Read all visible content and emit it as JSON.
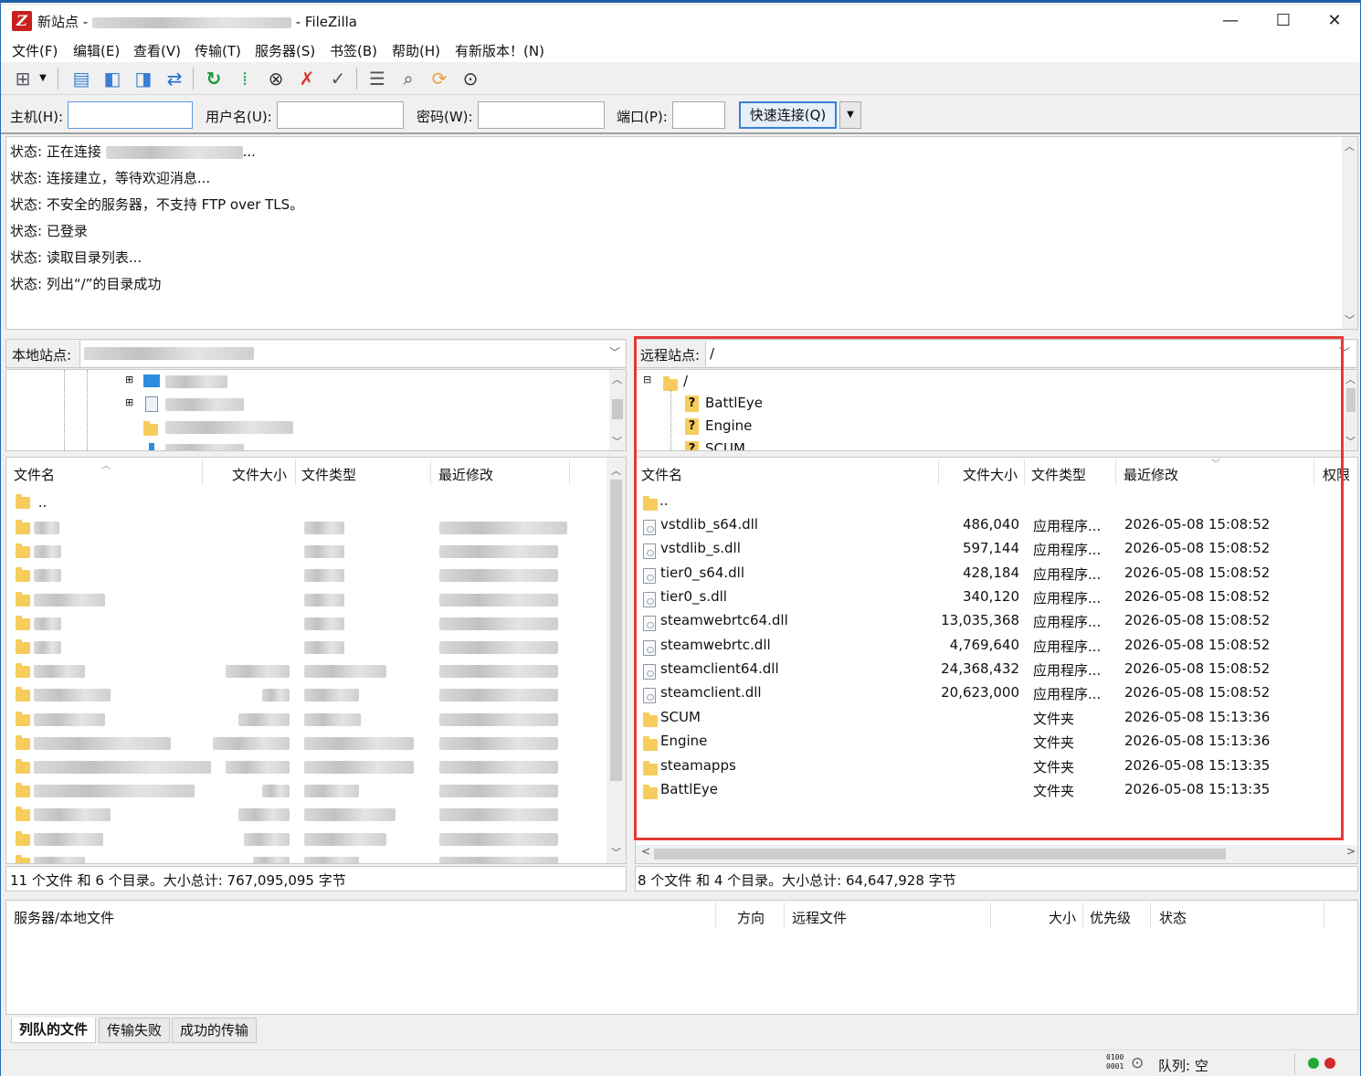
{
  "window": {
    "app_title": "新站点 - ",
    "app_name_suffix": "- FileZilla",
    "minimize": "—",
    "maximize": "☐",
    "close": "✕"
  },
  "menu": [
    "文件(F)",
    "编辑(E)",
    "查看(V)",
    "传输(T)",
    "服务器(S)",
    "书签(B)",
    "帮助(H)",
    "有新版本！(N)"
  ],
  "quickconnect": {
    "host_label": "主机(H):",
    "user_label": "用户名(U):",
    "pass_label": "密码(W):",
    "port_label": "端口(P):",
    "connect_label": "快速连接(Q)",
    "host_value": "",
    "user_value": "",
    "pass_value": "",
    "port_value": ""
  },
  "log": [
    {
      "text": "状态: 正在连接 ",
      "suffix": "..."
    },
    {
      "text": "状态: 连接建立，等待欢迎消息...",
      "suffix": ""
    },
    {
      "text": "状态: 不安全的服务器，不支持 FTP over TLS。",
      "suffix": ""
    },
    {
      "text": "状态: 已登录",
      "suffix": ""
    },
    {
      "text": "状态: 读取目录列表...",
      "suffix": ""
    },
    {
      "text": "状态: 列出“/”的目录成功",
      "suffix": ""
    }
  ],
  "local": {
    "site_label": "本地站点:",
    "columns": {
      "name": "文件名",
      "size": "文件大小",
      "type": "文件类型",
      "modified": "最近修改"
    },
    "parent": "..",
    "status": "11 个文件 和 6 个目录。大小总计: 767,095,095 字节"
  },
  "remote": {
    "site_label": "远程站点:",
    "path": "/",
    "tree": {
      "root": "/",
      "children": [
        "BattlEye",
        "Engine",
        "SCUM"
      ]
    },
    "columns": {
      "name": "文件名",
      "size": "文件大小",
      "type": "文件类型",
      "modified": "最近修改",
      "perm": "权限"
    },
    "parent": "..",
    "files": [
      {
        "name": "vstdlib_s64.dll",
        "size": "486,040",
        "type": "应用程序...",
        "modified": "2026-05-08 15:08:52",
        "kind": "file"
      },
      {
        "name": "vstdlib_s.dll",
        "size": "597,144",
        "type": "应用程序...",
        "modified": "2026-05-08 15:08:52",
        "kind": "file"
      },
      {
        "name": "tier0_s64.dll",
        "size": "428,184",
        "type": "应用程序...",
        "modified": "2026-05-08 15:08:52",
        "kind": "file"
      },
      {
        "name": "tier0_s.dll",
        "size": "340,120",
        "type": "应用程序...",
        "modified": "2026-05-08 15:08:52",
        "kind": "file"
      },
      {
        "name": "steamwebrtc64.dll",
        "size": "13,035,368",
        "type": "应用程序...",
        "modified": "2026-05-08 15:08:52",
        "kind": "file"
      },
      {
        "name": "steamwebrtc.dll",
        "size": "4,769,640",
        "type": "应用程序...",
        "modified": "2026-05-08 15:08:52",
        "kind": "file"
      },
      {
        "name": "steamclient64.dll",
        "size": "24,368,432",
        "type": "应用程序...",
        "modified": "2026-05-08 15:08:52",
        "kind": "file"
      },
      {
        "name": "steamclient.dll",
        "size": "20,623,000",
        "type": "应用程序...",
        "modified": "2026-05-08 15:08:52",
        "kind": "file"
      },
      {
        "name": "SCUM",
        "size": "",
        "type": "文件夹",
        "modified": "2026-05-08 15:13:36",
        "kind": "folder"
      },
      {
        "name": "Engine",
        "size": "",
        "type": "文件夹",
        "modified": "2026-05-08 15:13:36",
        "kind": "folder"
      },
      {
        "name": "steamapps",
        "size": "",
        "type": "文件夹",
        "modified": "2026-05-08 15:13:35",
        "kind": "folder"
      },
      {
        "name": "BattlEye",
        "size": "",
        "type": "文件夹",
        "modified": "2026-05-08 15:13:35",
        "kind": "folder"
      }
    ],
    "status": "8 个文件 和 4 个目录。大小总计: 64,647,928 字节"
  },
  "queue": {
    "columns": {
      "server": "服务器/本地文件",
      "direction": "方向",
      "remote": "远程文件",
      "size": "大小",
      "priority": "优先级",
      "status": "状态"
    },
    "tabs": [
      "列队的文件",
      "传输失败",
      "成功的传输"
    ]
  },
  "statusbar": {
    "queue": "队列: 空",
    "binary_icon": "0100 0001"
  },
  "colors": {
    "highlight": "#e53935",
    "accent": "#3a7fd5",
    "folder": "#f6cd5c"
  }
}
